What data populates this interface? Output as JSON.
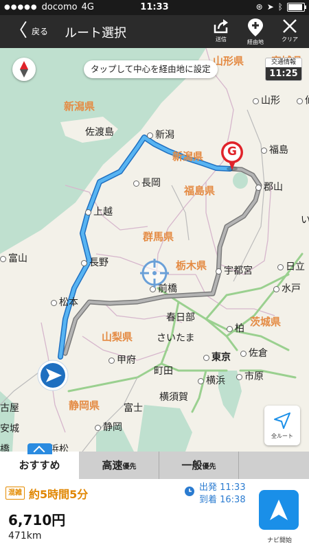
{
  "status_bar": {
    "carrier": "docomo",
    "network": "4G",
    "time": "11:33"
  },
  "nav": {
    "back_label": "戻る",
    "title": "ルート選択",
    "actions": {
      "share": "送信",
      "waypoint": "経由地",
      "clear": "クリア"
    }
  },
  "map": {
    "tip": "タップして中心を経由地に設定",
    "traffic": {
      "label": "交通情報",
      "time": "11:25"
    },
    "goal_letter": "G",
    "prefectures": {
      "yamagata": "山形県",
      "miyagi": "宮城県",
      "niigata_top": "新潟県",
      "niigata": "新潟県",
      "fukushima": "福島県",
      "gunma": "群馬県",
      "tochigi": "栃木県",
      "ibaraki": "茨城県",
      "yamanashi": "山梨県",
      "shizuoka": "静岡県"
    },
    "cities": {
      "sado": "佐渡島",
      "niigata": "新潟",
      "nagaoka": "長岡",
      "joetsu": "上越",
      "nagano": "長野",
      "matsumoto": "松本",
      "toyama": "富山",
      "maebashi": "前橋",
      "utsunomiya": "宇都宮",
      "koriyama": "郡山",
      "fukushima": "福島",
      "yamagata": "山形",
      "sendai_edge": "仙",
      "hitachi": "日立",
      "mito": "水戸",
      "kasukabe": "春日部",
      "kashiwa": "柏",
      "saitama": "さいたま",
      "tokyo": "東京",
      "sakura": "佐倉",
      "ichihara": "市原",
      "kofu": "甲府",
      "machida": "町田",
      "yokohama": "横浜",
      "yokosuka": "横須賀",
      "fuji": "富士",
      "shizuoka": "静岡",
      "nagoya_part": "古屋",
      "anjo_part": "安城",
      "hamamatsu_part": "浜松",
      "toyohashi_part": "橋",
      "iwaki_part": "い"
    },
    "full_route_label": "全ルート"
  },
  "tabs": [
    {
      "label": "おすすめ",
      "suffix": ""
    },
    {
      "label": "高速",
      "suffix": "優先"
    },
    {
      "label": "一般",
      "suffix": "優先"
    }
  ],
  "route": {
    "congestion_badge": "混雑",
    "duration": "約5時間5分",
    "departure": "出発 11:33",
    "arrival": "到着 16:38",
    "fare": "6,710円",
    "distance": "471km",
    "navi_label": "ナビ開始"
  },
  "colors": {
    "route_primary": "#4aa8ee",
    "route_alt": "#8a8a8a",
    "prefecture_label": "#e48b44",
    "goal_red": "#e0232a",
    "accent_blue": "#1a8fe8"
  }
}
